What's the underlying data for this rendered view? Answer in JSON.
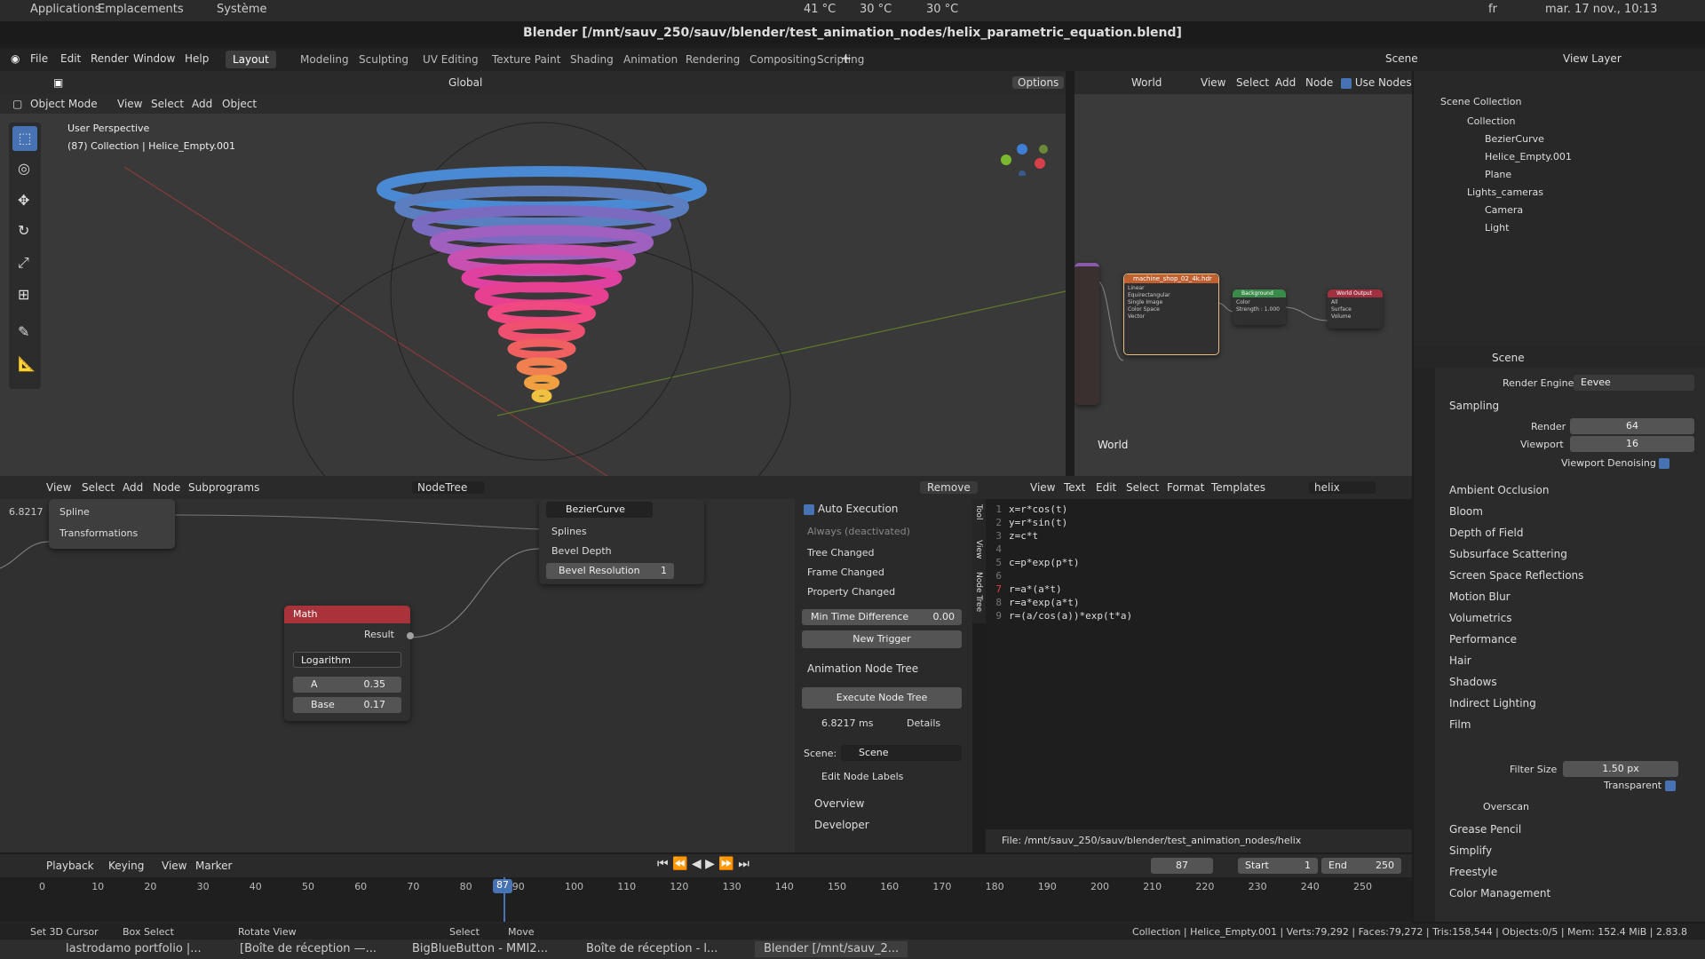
{
  "os": {
    "applications": "Applications",
    "places": "Emplacements",
    "system": "Système",
    "temp1": "41 °C",
    "temp2": "30 °C",
    "temp3": "30 °C",
    "lang": "fr",
    "datetime": "mar. 17 nov., 10:13"
  },
  "window_title": "Blender [/mnt/sauv_250/sauv/blender/test_animation_nodes/helix_parametric_equation.blend]",
  "menu": [
    "File",
    "Edit",
    "Render",
    "Window",
    "Help"
  ],
  "workspaces": [
    "Layout",
    "Modeling",
    "Sculpting",
    "UV Editing",
    "Texture Paint",
    "Shading",
    "Animation",
    "Rendering",
    "Compositing",
    "Scripting"
  ],
  "active_workspace": "Layout",
  "top_right": {
    "scene": "Scene",
    "view_layer": "View Layer"
  },
  "viewport": {
    "mode": "Object Mode",
    "menus": [
      "View",
      "Select",
      "Add",
      "Object"
    ],
    "transform": "Global",
    "options": "Options",
    "perspective": "User Perspective",
    "collection_info": "(87) Collection | Helice_Empty.001"
  },
  "node_editor": {
    "world_label": "World",
    "world_name": "World",
    "menus": [
      "View",
      "Select",
      "Add",
      "Node"
    ],
    "use_nodes": "Use Nodes",
    "nodes": {
      "texture_title": "machine_shop_02_4k.hdr",
      "background_title": "Background",
      "output_title": "World Output",
      "bg_label": "Background",
      "color_label": "Color",
      "strength_label": "Strength : 1.000",
      "surface": "Surface",
      "volume": "Volume",
      "all": "All",
      "linear": "Linear",
      "equirect": "Equirectangular",
      "single": "Single Image",
      "colorspace": "Color Space",
      "linear2": "Linear",
      "vector": "Vector"
    }
  },
  "outliner": {
    "scene_collection": "Scene Collection",
    "items": [
      {
        "name": "Collection",
        "level": 1
      },
      {
        "name": "BezierCurve",
        "level": 2
      },
      {
        "name": "Helice_Empty.001",
        "level": 2
      },
      {
        "name": "Plane",
        "level": 2
      },
      {
        "name": "Lights_cameras",
        "level": 1
      },
      {
        "name": "Camera",
        "level": 2
      },
      {
        "name": "Light",
        "level": 2
      }
    ]
  },
  "props": {
    "scene": "Scene",
    "render_engine_label": "Render Engine",
    "render_engine": "Eevee",
    "sampling": "Sampling",
    "render_label": "Render",
    "render_val": "64",
    "viewport_label": "Viewport",
    "viewport_val": "16",
    "denoise": "Viewport Denoising",
    "sections": [
      "Ambient Occlusion",
      "Bloom",
      "Depth of Field",
      "Subsurface Scattering",
      "Screen Space Reflections",
      "Motion Blur",
      "Volumetrics",
      "Performance",
      "Hair",
      "Shadows",
      "Indirect Lighting",
      "Film"
    ],
    "filter_size_label": "Filter Size",
    "filter_size": "1.50 px",
    "transparent": "Transparent",
    "overscan": "Overscan",
    "after": [
      "Grease Pencil",
      "Simplify",
      "Freestyle",
      "Color Management"
    ]
  },
  "anim_nodes": {
    "menus": [
      "View",
      "Select",
      "Add",
      "Node",
      "Subprograms"
    ],
    "tree": "NodeTree",
    "remove": "Remove",
    "top_value": "6.8217",
    "top_sockets": [
      "Spline",
      "Transformations"
    ],
    "math": {
      "title": "Math",
      "result": "Result",
      "op": "Logarithm",
      "a_label": "A",
      "a_val": "0.35",
      "base_label": "Base",
      "base_val": "0.17"
    },
    "bezier": {
      "title": "BezierCurve",
      "splines": "Splines",
      "bevel_depth": "Bevel Depth",
      "bevel_res": "Bevel Resolution",
      "bevel_res_val": "1"
    }
  },
  "side": {
    "tabs": [
      "Tool",
      "View",
      "Node Tree"
    ],
    "auto_exec": "Auto Execution",
    "always": "Always (deactivated)",
    "tree_changed": "Tree Changed",
    "frame_changed": "Frame Changed",
    "prop_changed": "Property Changed",
    "min_time": "Min Time Difference",
    "min_time_val": "0.00",
    "new_trigger": "New Trigger",
    "ant": "Animation Node Tree",
    "execute": "Execute Node Tree",
    "time": "6.8217 ms",
    "details": "Details",
    "scene_label": "Scene:",
    "scene": "Scene",
    "edit_labels": "Edit Node Labels",
    "overview": "Overview",
    "developer": "Developer"
  },
  "text_editor": {
    "menus": [
      "View",
      "Text",
      "Edit",
      "Select",
      "Format",
      "Templates"
    ],
    "name": "helix",
    "lines": [
      "x=r*cos(t)",
      "y=r*sin(t)",
      "z=c*t",
      "",
      "c=p*exp(p*t)",
      "",
      "r=a*(a*t)",
      "r=a*exp(a*t)",
      "r=(a/cos(a))*exp(t*a)"
    ],
    "file": "File: /mnt/sauv_250/sauv/blender/test_animation_nodes/helix"
  },
  "timeline": {
    "menus": [
      "Playback",
      "Keying",
      "View",
      "Marker"
    ],
    "current": "87",
    "start_label": "Start",
    "start": "1",
    "end_label": "End",
    "end": "250",
    "ticks": [
      "0",
      "10",
      "20",
      "30",
      "40",
      "50",
      "60",
      "70",
      "80",
      "90",
      "100",
      "110",
      "120",
      "130",
      "140",
      "150",
      "160",
      "170",
      "180",
      "190",
      "200",
      "210",
      "220",
      "230",
      "240",
      "250"
    ]
  },
  "status": {
    "left": [
      "Set 3D Cursor",
      "Box Select",
      "Rotate View",
      "Select",
      "Move"
    ],
    "right": "Collection | Helice_Empty.001 | Verts:79,292 | Faces:79,272 | Tris:158,544 | Objects:0/5 | Mem: 152.4 MiB | 2.83.8"
  },
  "taskbar": [
    "lastrodamo portfolio |...",
    "[Boîte de réception —...",
    "BigBlueButton - MMI2...",
    "Boîte de réception - l...",
    "Blender [/mnt/sauv_2..."
  ]
}
